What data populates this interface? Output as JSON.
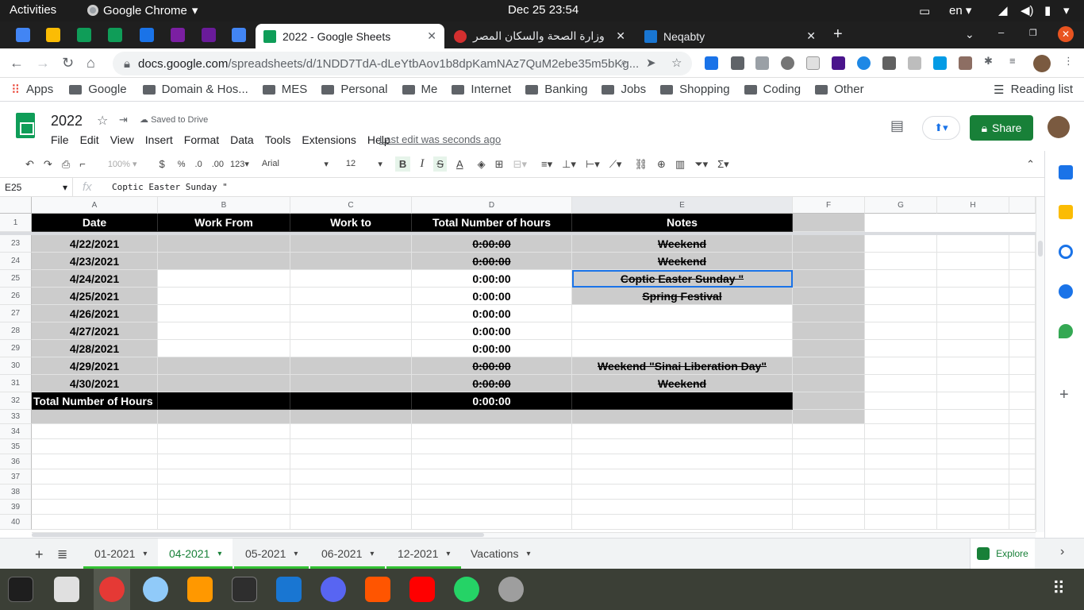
{
  "topbar": {
    "activities": "Activities",
    "app": "Google Chrome",
    "clock": "Dec 25  23:54",
    "lang": "en"
  },
  "tabs": [
    {
      "title": "2022 - Google Sheets"
    },
    {
      "title": "وزارة الصحة والسكان المصر"
    },
    {
      "title": "Neqabty"
    }
  ],
  "address": {
    "host": "docs.google.com",
    "path": "/spreadsheets/d/1NDD7TdA-dLeYtbAov1b8dpKamNAz7QuM2ebe35m5bKg..."
  },
  "bookmarks": [
    "Apps",
    "Google",
    "Domain & Hos...",
    "MES",
    "Personal",
    "Me",
    "Internet",
    "Banking",
    "Jobs",
    "Shopping",
    "Coding",
    "Other"
  ],
  "reading_list": "Reading list",
  "doc": {
    "title": "2022",
    "saved": "Saved to Drive",
    "menus": [
      "File",
      "Edit",
      "View",
      "Insert",
      "Format",
      "Data",
      "Tools",
      "Extensions",
      "Help"
    ],
    "last_edit": "Last edit was seconds ago",
    "share": "Share"
  },
  "toolbar": {
    "zoom": "100%",
    "currency": "$",
    "percent": "%",
    "dec1": ".0",
    "dec2": ".00",
    "fmt": "123",
    "font": "Arial",
    "size": "12"
  },
  "formula": {
    "cell": "E25",
    "fx": "fx",
    "value": "Coptic Easter Sunday \""
  },
  "columns": [
    "A",
    "B",
    "C",
    "D",
    "E",
    "F",
    "G",
    "H"
  ],
  "header_row": {
    "num": "1",
    "cells": [
      "Date",
      "Work From",
      "Work to",
      "Total Number of hours",
      "Notes"
    ]
  },
  "rows": [
    {
      "num": "23",
      "date": "4/22/2021",
      "hours": "0:00:00",
      "note": "Weekend"
    },
    {
      "num": "24",
      "date": "4/23/2021",
      "hours": "0:00:00",
      "note": "Weekend"
    },
    {
      "num": "25",
      "date": "4/24/2021",
      "hours": "0:00:00",
      "note": "Coptic Easter Sunday \""
    },
    {
      "num": "26",
      "date": "4/25/2021",
      "hours": "0:00:00",
      "note": "Spring Festival"
    },
    {
      "num": "27",
      "date": "4/26/2021",
      "hours": "0:00:00",
      "note": ""
    },
    {
      "num": "28",
      "date": "4/27/2021",
      "hours": "0:00:00",
      "note": ""
    },
    {
      "num": "29",
      "date": "4/28/2021",
      "hours": "0:00:00",
      "note": ""
    },
    {
      "num": "30",
      "date": "4/29/2021",
      "hours": "0:00:00",
      "note": "Weekend \"Sinai Liberation Day\""
    },
    {
      "num": "31",
      "date": "4/30/2021",
      "hours": "0:00:00",
      "note": "Weekend"
    }
  ],
  "total_row": {
    "num": "32",
    "label": "Total Number of Hours",
    "hours": "0:00:00"
  },
  "empty_rows": [
    "33",
    "34",
    "35",
    "36",
    "37",
    "38",
    "39",
    "40"
  ],
  "sheets": [
    "01-2021",
    "04-2021",
    "05-2021",
    "06-2021",
    "12-2021",
    "Vacations"
  ],
  "explore": "Explore"
}
